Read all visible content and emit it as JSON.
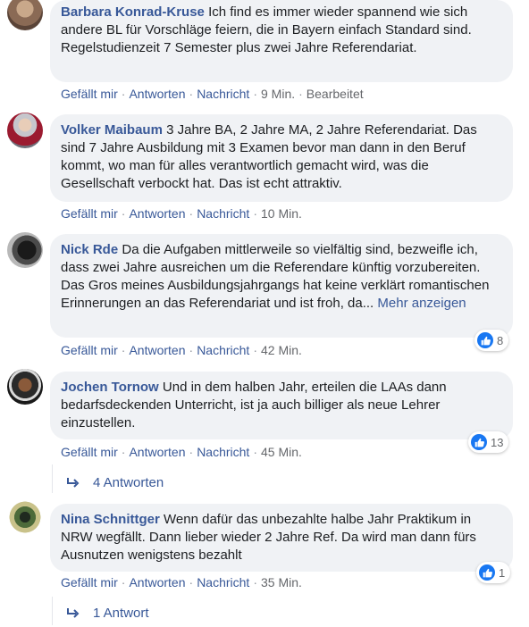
{
  "comments": [
    {
      "author": "Barbara Konrad-Kruse",
      "text": "Ich find es immer wieder spannend wie sich andere BL für Vorschläge feiern, die in Bayern einfach Standard sind.",
      "text2": "Regelstudienzeit 7 Semester plus zwei Jahre Referendariat.",
      "like": "Gefällt mir",
      "reply": "Antworten",
      "message": "Nachricht",
      "time": "9 Min.",
      "edited": "Bearbeitet"
    },
    {
      "author": "Volker Maibaum",
      "text": "3 Jahre BA, 2 Jahre MA, 2 Jahre Referendariat. Das sind 7 Jahre Ausbildung mit 3 Examen bevor man dann in den Beruf kommt, wo man für alles verantwortlich gemacht wird, was die Gesellschaft verbockt hat. Das ist echt attraktiv.",
      "like": "Gefällt mir",
      "reply": "Antworten",
      "message": "Nachricht",
      "time": "10 Min."
    },
    {
      "author": "Nick Rde",
      "text": "Da die Aufgaben mittlerweile so vielfältig sind, bezweifle ich, dass zwei Jahre ausreichen um die Referendare künftig vorzubereiten. Das Gros meines Ausbildungsjahrgangs hat keine verklärt romantischen Erinnerungen an das Referendariat und ist froh, da...",
      "more": "Mehr anzeigen",
      "like": "Gefällt mir",
      "reply": "Antworten",
      "message": "Nachricht",
      "time": "42 Min.",
      "reactions": "8"
    },
    {
      "author": "Jochen Tornow",
      "text": "Und in dem halben Jahr, erteilen die LAAs dann bedarfsdeckenden Unterricht, ist ja auch billiger als neue Lehrer einzustellen.",
      "like": "Gefällt mir",
      "reply": "Antworten",
      "message": "Nachricht",
      "time": "45 Min.",
      "reactions": "13",
      "replies": "4 Antworten"
    },
    {
      "author": "Nina Schnittger",
      "text": "Wenn dafür das unbezahlte halbe Jahr Praktikum in NRW wegfällt. Dann lieber wieder 2 Jahre Ref. Da wird man dann fürs Ausnutzen wenigstens bezahlt",
      "like": "Gefällt mir",
      "reply": "Antworten",
      "message": "Nachricht",
      "time": "35 Min.",
      "reactions": "1",
      "replies": "1 Antwort"
    }
  ],
  "colors": {
    "author": "#385898",
    "bubble": "#f0f2f5",
    "like_blue": "#1877f2",
    "meta": "#65676b"
  }
}
